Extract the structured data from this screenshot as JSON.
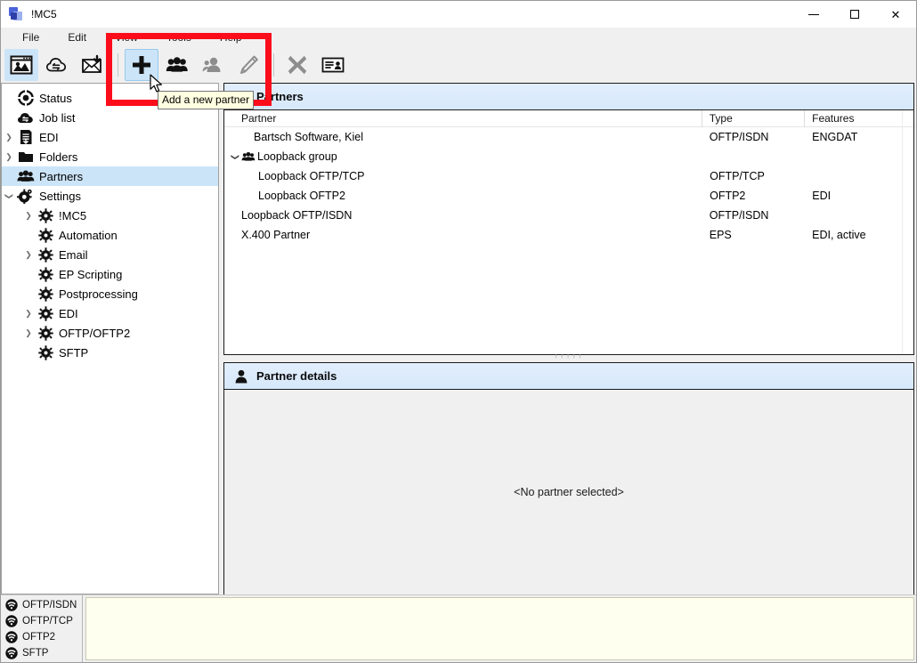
{
  "window": {
    "title": "!MC5",
    "app_icon": "mc5-logo-icon",
    "controls": {
      "minimize": "minimize-icon",
      "maximize": "maximize-icon",
      "close": "close-icon"
    }
  },
  "menubar": {
    "items": [
      {
        "label": "File"
      },
      {
        "label": "Edit"
      },
      {
        "label": "View"
      },
      {
        "label": "Tools"
      },
      {
        "label": "Help"
      }
    ]
  },
  "toolbar": {
    "buttons": [
      {
        "name": "status-window-button",
        "icon": "monitor-gear-icon",
        "state": "selected"
      },
      {
        "name": "job-list-button",
        "icon": "cloud-transfer-icon",
        "state": "normal"
      },
      {
        "name": "receive-mail-button",
        "icon": "envelope-download-icon",
        "state": "normal"
      },
      {
        "name": "add-partner-button",
        "icon": "plus-icon",
        "state": "hover"
      },
      {
        "name": "add-group-button",
        "icon": "group-people-icon",
        "state": "normal"
      },
      {
        "name": "add-contact-button",
        "icon": "single-person-icon",
        "state": "disabled"
      },
      {
        "name": "edit-partner-button",
        "icon": "pencil-icon",
        "state": "disabled"
      },
      {
        "name": "delete-partner-button",
        "icon": "x-delete-icon",
        "state": "disabled"
      },
      {
        "name": "partner-card-button",
        "icon": "contact-card-icon",
        "state": "normal"
      }
    ]
  },
  "tooltip": {
    "text": "Add a new partner"
  },
  "sidebar": {
    "items": [
      {
        "label": "Status",
        "icon": "status-circle-icon",
        "indent": 0,
        "expander": "",
        "selected": false
      },
      {
        "label": "Job list",
        "icon": "cloud-jobs-icon",
        "indent": 0,
        "expander": "",
        "selected": false
      },
      {
        "label": "EDI",
        "icon": "edi-document-icon",
        "indent": 0,
        "expander": "collapsed",
        "selected": false
      },
      {
        "label": "Folders",
        "icon": "folder-icon",
        "indent": 0,
        "expander": "collapsed",
        "selected": false
      },
      {
        "label": "Partners",
        "icon": "partners-group-icon",
        "indent": 0,
        "expander": "",
        "selected": true
      },
      {
        "label": "Settings",
        "icon": "settings-gears-icon",
        "indent": 0,
        "expander": "expanded",
        "selected": false
      },
      {
        "label": "!MC5",
        "icon": "gear-icon",
        "indent": 1,
        "expander": "collapsed",
        "selected": false
      },
      {
        "label": "Automation",
        "icon": "gear-icon",
        "indent": 1,
        "expander": "",
        "selected": false
      },
      {
        "label": "Email",
        "icon": "gear-icon",
        "indent": 1,
        "expander": "collapsed",
        "selected": false
      },
      {
        "label": "EP Scripting",
        "icon": "gear-icon",
        "indent": 1,
        "expander": "",
        "selected": false
      },
      {
        "label": "Postprocessing",
        "icon": "gear-icon",
        "indent": 1,
        "expander": "",
        "selected": false
      },
      {
        "label": "EDI",
        "icon": "gear-icon",
        "indent": 1,
        "expander": "collapsed",
        "selected": false
      },
      {
        "label": "OFTP/OFTP2",
        "icon": "gear-icon",
        "indent": 1,
        "expander": "collapsed",
        "selected": false
      },
      {
        "label": "SFTP",
        "icon": "gear-icon",
        "indent": 1,
        "expander": "",
        "selected": false
      }
    ]
  },
  "partners_panel": {
    "title": "Partners",
    "icon": "partners-group-icon",
    "columns": [
      {
        "label": "Partner",
        "sorted": "asc"
      },
      {
        "label": "Type",
        "sorted": ""
      },
      {
        "label": "Features",
        "sorted": ""
      }
    ],
    "rows": [
      {
        "name": "Bartsch Software, Kiel",
        "type": "OFTP/ISDN",
        "features": "ENGDAT",
        "indent": 0,
        "expander": "",
        "icon": ""
      },
      {
        "name": "Loopback group",
        "type": "",
        "features": "",
        "indent": 0,
        "expander": "expanded",
        "icon": "group-people-icon"
      },
      {
        "name": "Loopback OFTP/TCP",
        "type": "OFTP/TCP",
        "features": "",
        "indent": 1,
        "expander": "",
        "icon": ""
      },
      {
        "name": "Loopback OFTP2",
        "type": "OFTP2",
        "features": "EDI",
        "indent": 1,
        "expander": "",
        "icon": ""
      },
      {
        "name": "Loopback OFTP/ISDN",
        "type": "OFTP/ISDN",
        "features": "",
        "indent": 0,
        "expander": "",
        "icon": ""
      },
      {
        "name": "X.400 Partner",
        "type": "EPS",
        "features": "EDI, active",
        "indent": 0,
        "expander": "",
        "icon": ""
      }
    ]
  },
  "details_panel": {
    "title": "Partner details",
    "icon": "person-icon",
    "empty_text": "<No partner selected>"
  },
  "statusbar": {
    "protocols": [
      {
        "label": "OFTP/ISDN",
        "icon": "signal-icon"
      },
      {
        "label": "OFTP/TCP",
        "icon": "signal-icon"
      },
      {
        "label": "OFTP2",
        "icon": "signal-icon"
      },
      {
        "label": "SFTP",
        "icon": "signal-icon"
      }
    ],
    "log_text": ""
  },
  "annotation": {
    "highlight_color": "#fc0d1b"
  }
}
